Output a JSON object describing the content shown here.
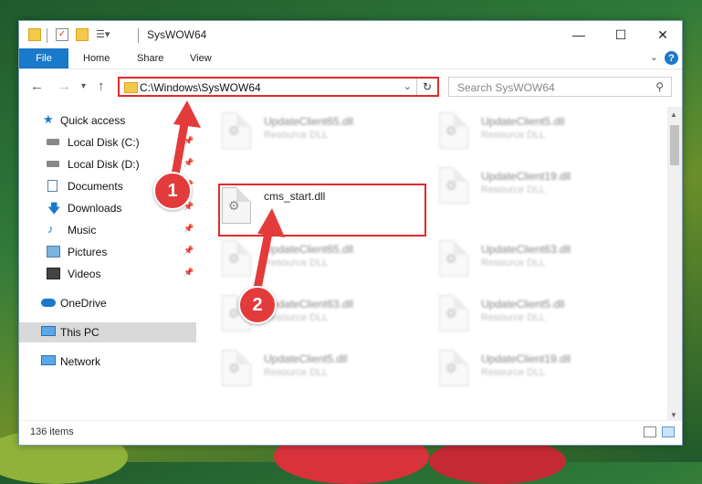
{
  "window": {
    "title": "SysWOW64"
  },
  "window_controls": {
    "minimize": "—",
    "maximize": "☐",
    "close": "✕"
  },
  "ribbon": {
    "file_tab": "File",
    "tabs": [
      "Home",
      "Share",
      "View"
    ],
    "help": "?"
  },
  "address_bar": {
    "path": "C:\\Windows\\SysWOW64"
  },
  "search": {
    "placeholder": "Search SysWOW64"
  },
  "sidebar": {
    "items": [
      {
        "label": "Quick access",
        "icon": "star-icon",
        "pinned": false
      },
      {
        "label": "Local Disk (C:)",
        "icon": "drive-icon",
        "pinned": true
      },
      {
        "label": "Local Disk (D:)",
        "icon": "drive-icon",
        "pinned": true
      },
      {
        "label": "Documents",
        "icon": "documents-icon",
        "pinned": true
      },
      {
        "label": "Downloads",
        "icon": "download-arrow-icon",
        "pinned": true
      },
      {
        "label": "Music",
        "icon": "music-note-icon",
        "pinned": true
      },
      {
        "label": "Pictures",
        "icon": "pictures-icon",
        "pinned": true
      },
      {
        "label": "Videos",
        "icon": "film-icon",
        "pinned": true
      },
      {
        "label": "OneDrive",
        "icon": "cloud-icon",
        "pinned": false
      },
      {
        "label": "This PC",
        "icon": "monitor-icon",
        "pinned": false,
        "selected": true
      },
      {
        "label": "Network",
        "icon": "network-icon",
        "pinned": false
      }
    ]
  },
  "files": [
    {
      "name": "UpdateClient65.dll",
      "type": "Resource DLL",
      "blurred": true
    },
    {
      "name": "UpdateClient5.dll",
      "type": "Resource DLL",
      "blurred": true
    },
    {
      "name": "cms_start.dll",
      "type": "",
      "blurred": false,
      "highlighted": true
    },
    {
      "name": "UpdateClient19.dll",
      "type": "Resource DLL",
      "blurred": true
    },
    {
      "name": "UpdateClient65.dll",
      "type": "Resource DLL",
      "blurred": true
    },
    {
      "name": "UpdateClient63.dll",
      "type": "Resource DLL",
      "blurred": true
    },
    {
      "name": "UpdateClient63.dll",
      "type": "Resource DLL",
      "blurred": true
    },
    {
      "name": "UpdateClient5.dll",
      "type": "Resource DLL",
      "blurred": true
    },
    {
      "name": "UpdateClient5.dll",
      "type": "Resource DLL",
      "blurred": true
    },
    {
      "name": "UpdateClient19.dll",
      "type": "Resource DLL",
      "blurred": true
    }
  ],
  "status": {
    "item_count": "136 items"
  },
  "annotations": {
    "marker1": "1",
    "marker2": "2",
    "color": "#e33b3b"
  }
}
